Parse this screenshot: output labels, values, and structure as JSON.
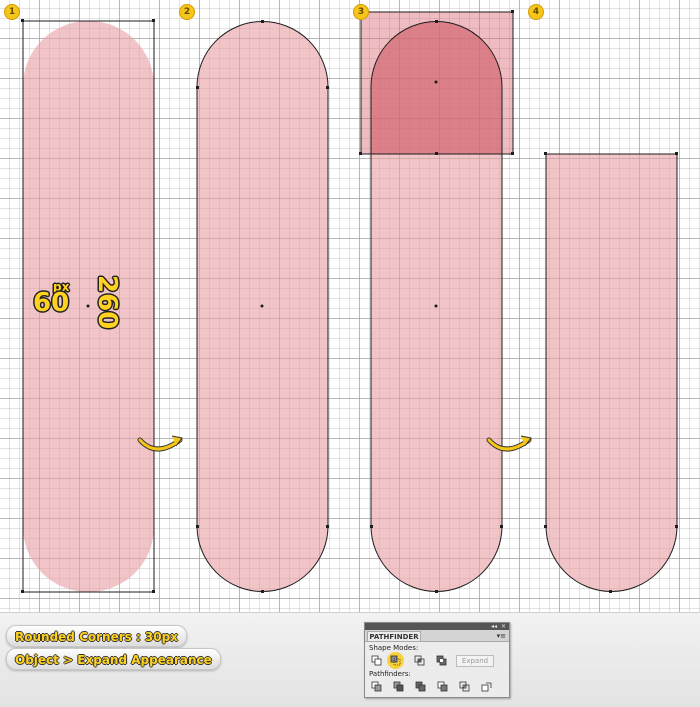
{
  "steps": {
    "labels": [
      "1",
      "2",
      "3",
      "4"
    ],
    "width": {
      "value": "60",
      "unit": "px"
    },
    "height": {
      "value": "260"
    }
  },
  "footer": {
    "note_rounded": "Rounded Corners : 30px",
    "note_expand": "Object > Expand Appearance"
  },
  "pathfinder": {
    "tab": "PATHFINDER",
    "collapse_glyph": "◂◂",
    "close_glyph": "✕",
    "menu_glyph": "▾≡",
    "shape_modes_label": "Shape Modes:",
    "pathfinders_label": "Pathfinders:",
    "expand_label": "Expand"
  },
  "colors": {
    "shape_fill": "#e8a0a6",
    "overlay_fill": "#d8626c",
    "accent_yellow": "#f5c518"
  },
  "icons": [
    "curved-arrow-icon",
    "unite-icon",
    "minus-front-icon",
    "intersect-icon",
    "exclude-icon",
    "divide-icon",
    "trim-icon",
    "merge-icon",
    "crop-icon",
    "outline-icon",
    "minus-back-icon"
  ]
}
